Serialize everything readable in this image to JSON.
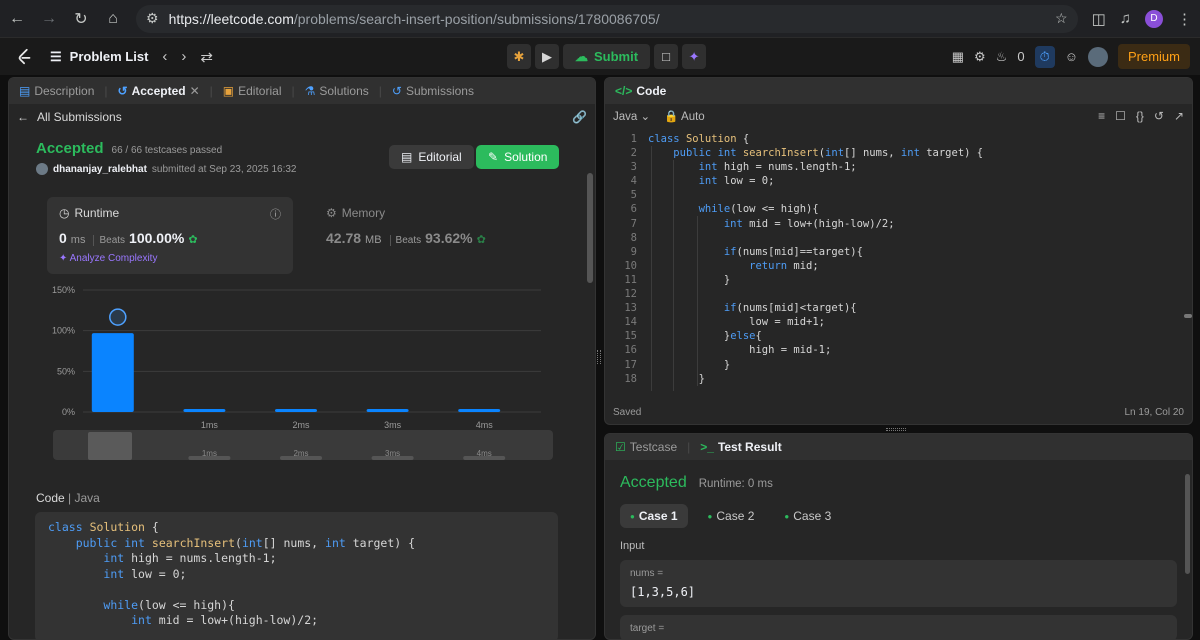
{
  "browser": {
    "url_host": "https://leetcode.com",
    "url_path": "/problems/search-insert-position/submissions/1780086705/",
    "profile_initial": "D"
  },
  "topbar": {
    "problem_list": "Problem List",
    "submit": "Submit",
    "coins": "0",
    "premium": "Premium"
  },
  "left_tabs": [
    {
      "label": "Description"
    },
    {
      "label": "Accepted"
    },
    {
      "label": "Editorial"
    },
    {
      "label": "Solutions"
    },
    {
      "label": "Submissions"
    }
  ],
  "submission": {
    "back": "All Submissions",
    "status": "Accepted",
    "passed": "66 / 66 testcases passed",
    "user": "dhananjay_ralebhat",
    "submitted": "submitted at Sep 23, 2025 16:32",
    "editorial_btn": "Editorial",
    "solution_btn": "Solution"
  },
  "runtime": {
    "title": "Runtime",
    "value": "0",
    "unit": "ms",
    "beats_label": "Beats",
    "beats": "100.00%",
    "analyze": "Analyze Complexity"
  },
  "memory": {
    "title": "Memory",
    "value": "42.78",
    "unit": "MB",
    "beats_label": "Beats",
    "beats": "93.62%"
  },
  "chart_data": {
    "type": "bar",
    "categories": [
      "",
      "1ms",
      "2ms",
      "3ms",
      "4ms"
    ],
    "values": [
      97,
      3,
      3,
      3,
      3
    ],
    "yticks": [
      "150%",
      "100%",
      "50%",
      "0%"
    ],
    "ylim": [
      0,
      150
    ],
    "grid": true,
    "bar_color": "#0a84ff",
    "overview_labels": [
      "1ms",
      "2ms",
      "3ms",
      "4ms"
    ]
  },
  "code_section": {
    "label": "Code",
    "lang": "Java",
    "lines": [
      "class Solution {",
      "    public int searchInsert(int[] nums, int target) {",
      "        int high = nums.length-1;",
      "        int low = 0;",
      "",
      "        while(low <= high){",
      "            int mid = low+(high-low)/2;"
    ]
  },
  "editor": {
    "title": "Code",
    "lang": "Java",
    "mode": "Auto",
    "saved": "Saved",
    "cursor": "Ln 19, Col 20",
    "lines": [
      "class Solution {",
      "    public int searchInsert(int[] nums, int target) {",
      "        int high = nums.length-1;",
      "        int low = 0;",
      "",
      "        while(low <= high){",
      "            int mid = low+(high-low)/2;",
      "",
      "            if(nums[mid]==target){",
      "                return mid;",
      "            }",
      "",
      "            if(nums[mid]<target){",
      "                low = mid+1;",
      "            }else{",
      "                high = mid-1;",
      "            }",
      "        }"
    ]
  },
  "test_panel": {
    "tab_testcase": "Testcase",
    "tab_result": "Test Result",
    "status": "Accepted",
    "runtime": "Runtime: 0 ms",
    "cases": [
      "Case 1",
      "Case 2",
      "Case 3"
    ],
    "input_label": "Input",
    "var_name": "nums =",
    "var_value": "[1,3,5,6]",
    "next_var": "target ="
  }
}
